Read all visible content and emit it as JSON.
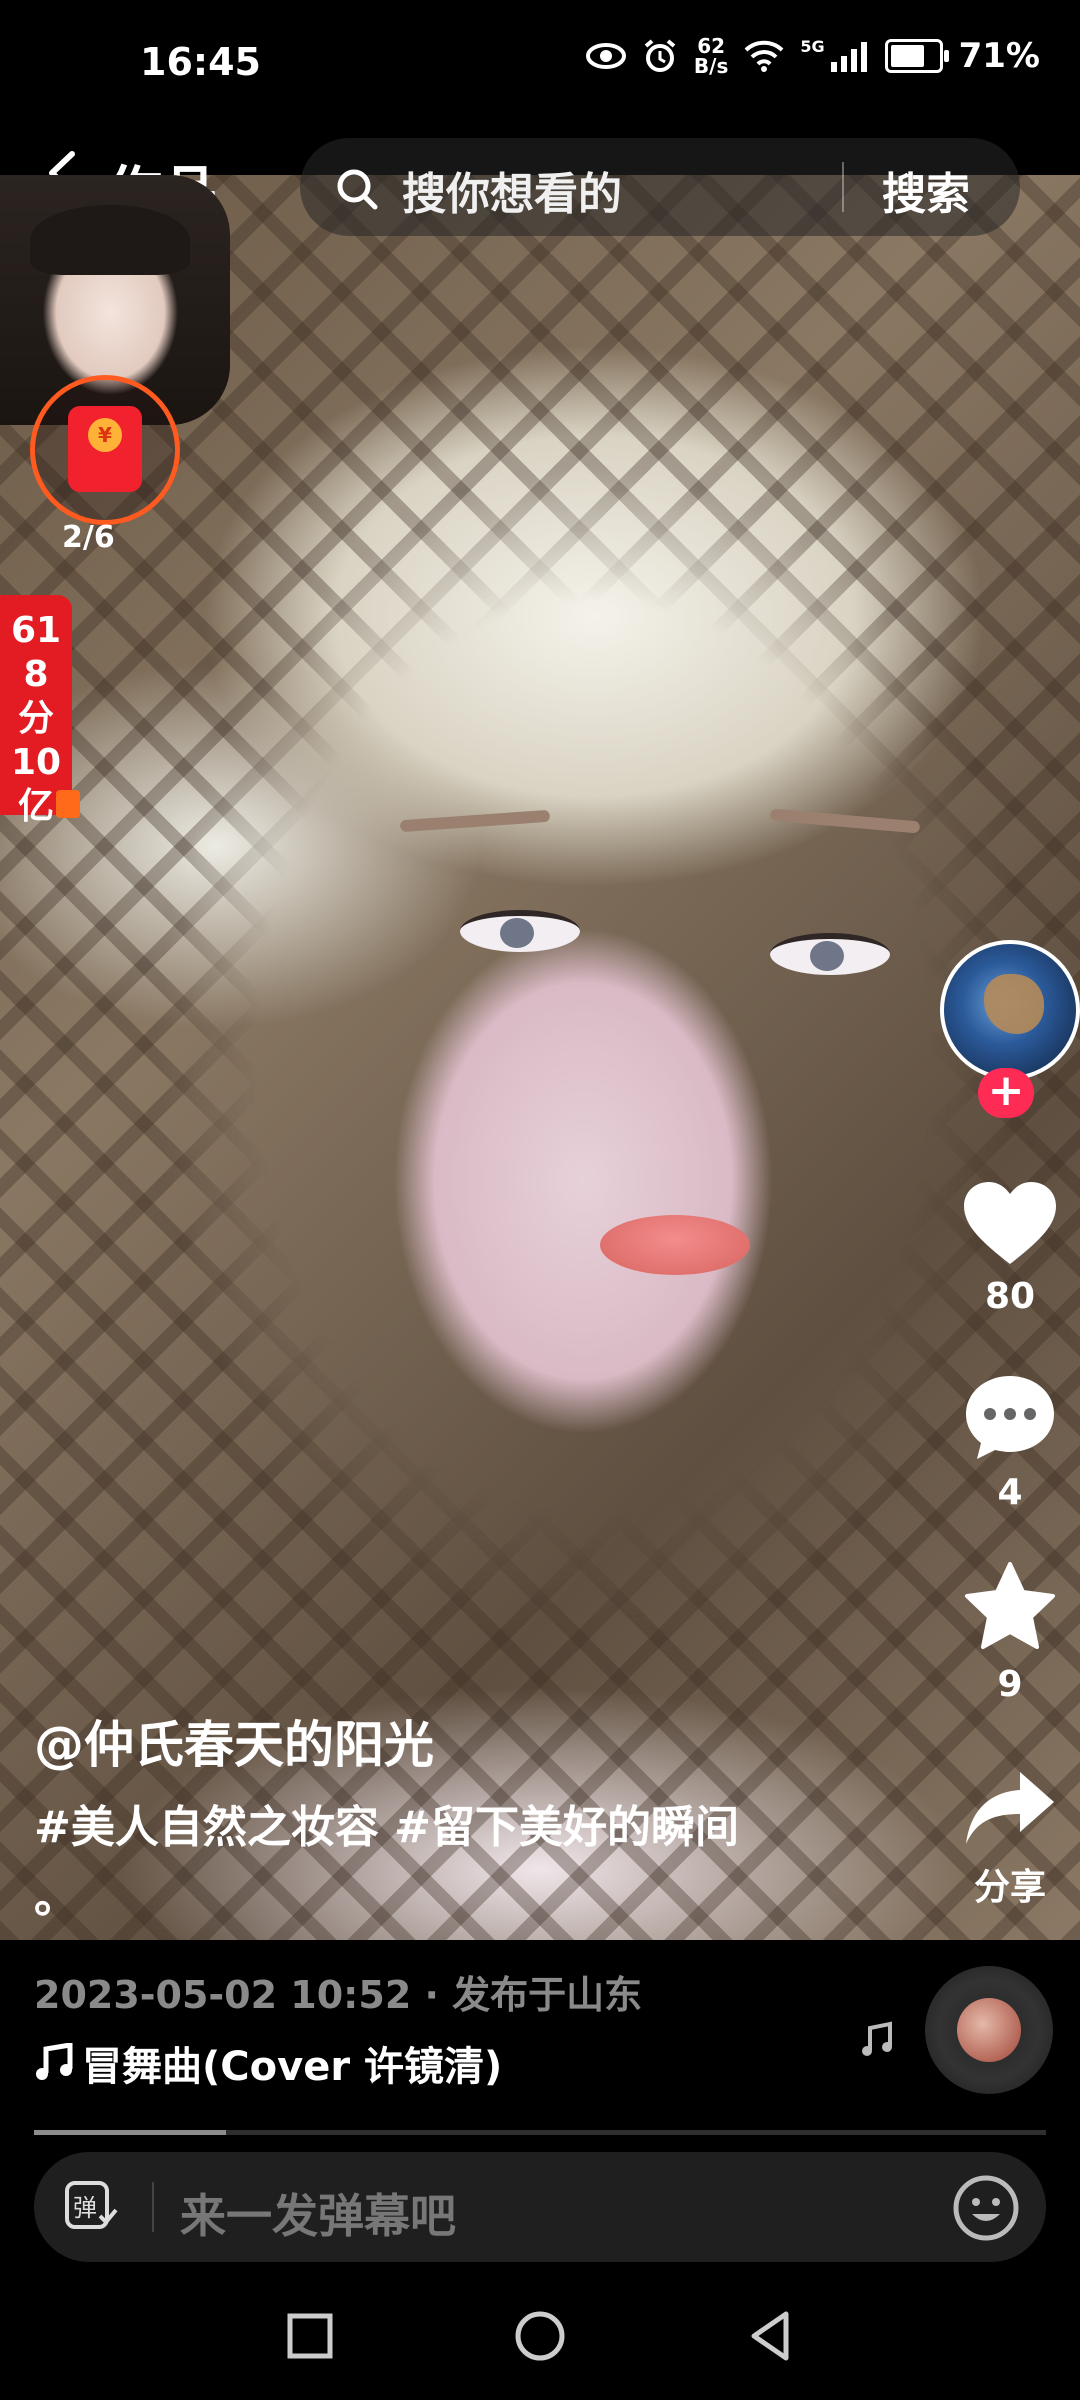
{
  "status_bar": {
    "time": "16:45",
    "net_speed_value": "62",
    "net_speed_unit": "B/s",
    "network": "5G",
    "battery_percent_label": "71%",
    "battery_level": 0.71
  },
  "top_bar": {
    "title": "作品",
    "search_placeholder": "搜你想看的",
    "search_button": "搜索"
  },
  "overlay": {
    "red_packet_progress": "2/6",
    "promo_label": "618分10亿"
  },
  "actions": {
    "likes": "80",
    "comments": "4",
    "favorites": "9",
    "share_label": "分享"
  },
  "caption": {
    "author": "@仲氏春天的阳光",
    "description": "#美人自然之妆容 #留下美好的瞬间 。"
  },
  "video_meta": {
    "date_location": "2023-05-02 10:52 · 发布于山东",
    "music": "冒舞曲(Cover 许镜清)",
    "progress": 0.19
  },
  "comment": {
    "placeholder": "来一发弹幕吧",
    "danmu_icon_label": "弹"
  },
  "colors": {
    "follow_accent": "#fe2c55",
    "promo_red": "#e31c24",
    "red_packet_ring": "#ff5a1f"
  },
  "icons": [
    "back-arrow-icon",
    "search-icon",
    "heart-icon",
    "comment-icon",
    "star-icon",
    "share-icon",
    "music-note-icon",
    "danmu-icon",
    "emoji-icon",
    "nav-square-icon",
    "nav-circle-icon",
    "nav-triangle-icon",
    "eye-icon",
    "alarm-icon",
    "wifi-icon",
    "signal-icon",
    "battery-icon"
  ]
}
